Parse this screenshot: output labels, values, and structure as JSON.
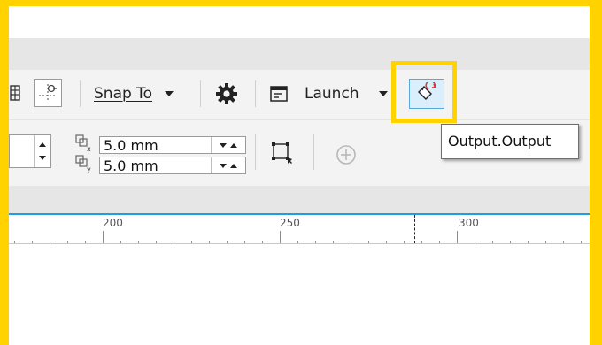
{
  "toolbar": {
    "snap_label": "Snap To",
    "launch_label": "Launch"
  },
  "properties": {
    "duplicate_x": "5.0 mm",
    "duplicate_y": "5.0 mm"
  },
  "ruler": {
    "labels": [
      "200",
      "250",
      "300"
    ]
  },
  "tooltip": {
    "text": "Output.Output"
  },
  "colors": {
    "highlight": "#FFD200",
    "accent_line": "#1A9EE6"
  },
  "icons": [
    "grid-icon",
    "snap-guides-icon",
    "gear-icon",
    "launch-window-icon",
    "output-icon",
    "duplicate-x-icon",
    "duplicate-y-icon",
    "frame-select-icon",
    "plus-circle-icon"
  ]
}
